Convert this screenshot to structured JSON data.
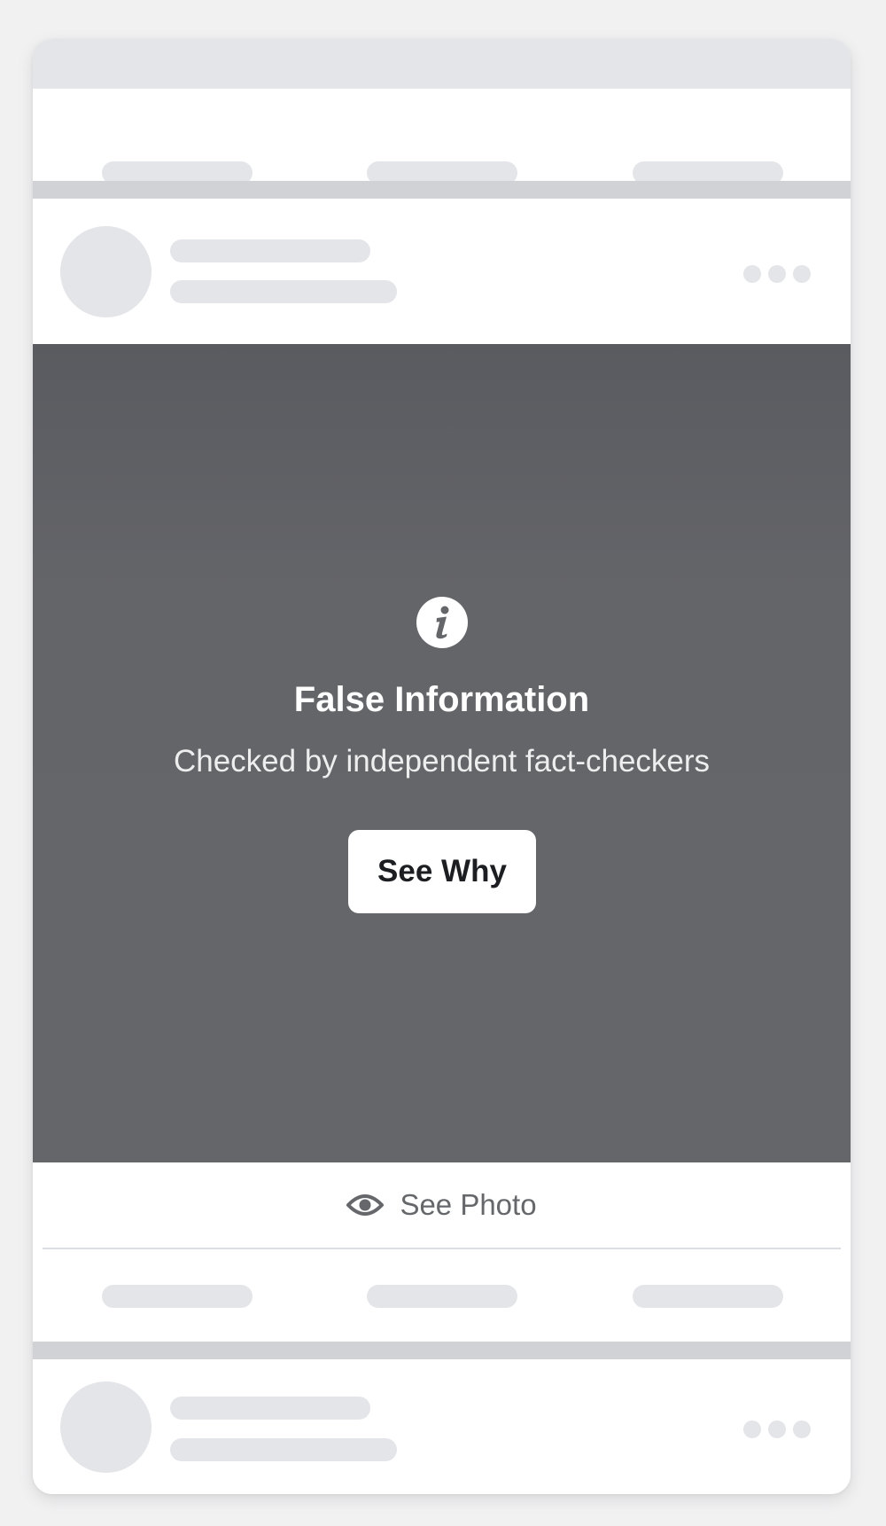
{
  "warning": {
    "icon": "info-icon",
    "title": "False Information",
    "subtitle": "Checked  by independent fact-checkers",
    "button_label": "See Why"
  },
  "see_photo": {
    "icon": "eye-icon",
    "label": "See Photo"
  },
  "colors": {
    "overlay": "#65666a",
    "placeholder": "#e4e5e9",
    "divider": "#d1d2d6",
    "secondary_text": "#65676b"
  }
}
